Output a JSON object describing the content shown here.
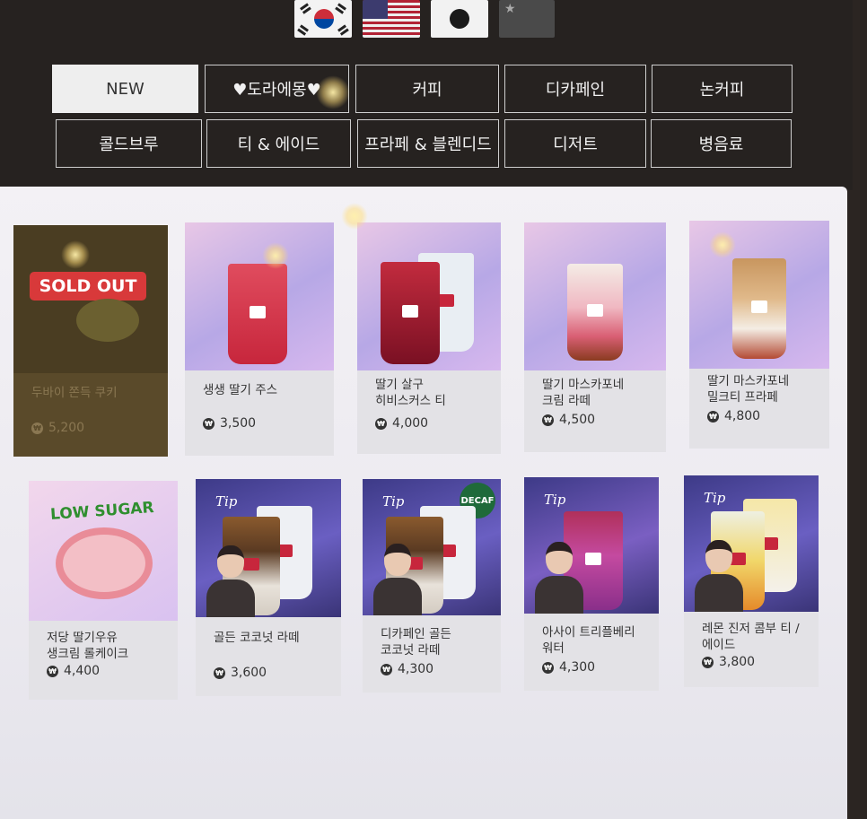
{
  "flags": [
    {
      "name": "korean-flag",
      "icon": "kr-flag"
    },
    {
      "name": "us-flag",
      "icon": "us-flag"
    },
    {
      "name": "japan-flag",
      "icon": "jp-flag"
    },
    {
      "name": "china-flag",
      "icon": "cn-flag"
    }
  ],
  "categories": {
    "new": "NEW",
    "doraemon": "♥도라에몽♥",
    "coffee": "커피",
    "decaf": "디카페인",
    "non_coffee": "논커피",
    "cold_brew": "콜드브루",
    "tea_ade": "티 & 에이드",
    "frappe_blended": "프라페 & 블렌디드",
    "dessert": "디저트",
    "bottled": "병음료"
  },
  "products": [
    {
      "name": "두바이 쫀득 쿠키",
      "price": "5,200",
      "badge": "SOLD OUT"
    },
    {
      "name": "생생 딸기 주스",
      "price": "3,500"
    },
    {
      "name": "딸기 살구\n히비스커스 티",
      "price": "4,000"
    },
    {
      "name": "딸기 마스카포네\n크림 라떼",
      "price": "4,500"
    },
    {
      "name": "딸기 마스카포네\n밀크티 프라페",
      "price": "4,800"
    },
    {
      "name": "저당 딸기우유\n생크림 롤케이크",
      "price": "4,400",
      "badge": "LOW SUGAR"
    },
    {
      "name": "골든 코코넛 라떼",
      "price": "3,600",
      "tag": "Tip"
    },
    {
      "name": "디카페인 골든\n코코넛 라떼",
      "price": "4,300",
      "tag": "Tip",
      "badge": "DECAF"
    },
    {
      "name": "아사이 트리플베리\n워터",
      "price": "4,300",
      "tag": "Tip"
    },
    {
      "name": "레몬 진저 콤부 티 /\n에이드",
      "price": "3,800",
      "tag": "Tip"
    }
  ],
  "currency_symbol": "₩",
  "colors": {
    "header_bg": "#262220",
    "sold_out_red": "#d8393a",
    "decaf_green": "#1f6a3a",
    "low_sugar_green": "#2f8f2f"
  }
}
